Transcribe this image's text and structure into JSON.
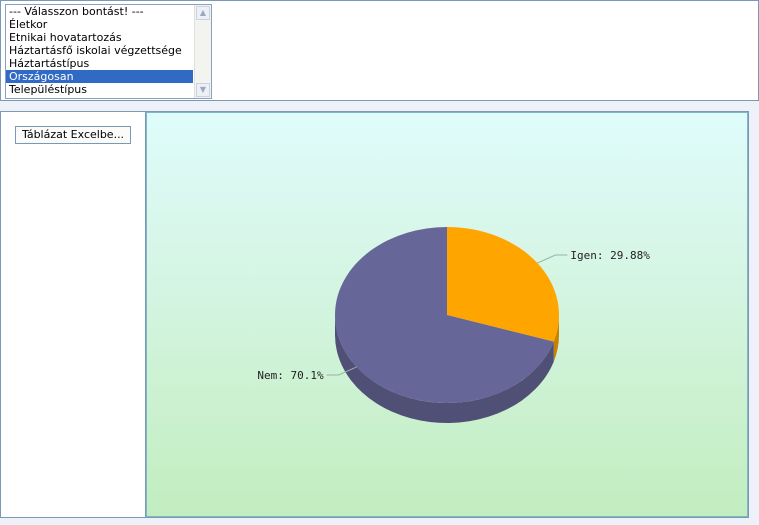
{
  "breakdown_select": {
    "options": [
      "--- Válasszon bontást! ---",
      "Életkor",
      "Etnikai hovatartozás",
      "Háztartásfő iskolai végzettsége",
      "Háztartástípus",
      "Országosan",
      "Településtípus"
    ],
    "selected": "Országosan"
  },
  "left_panel": {
    "excel_button_label": "Táblázat Excelbe..."
  },
  "chart_data": {
    "type": "pie",
    "slices": [
      {
        "name": "Igen",
        "value": 29.88,
        "label": "Igen: 29.88%",
        "color": "#ffa500"
      },
      {
        "name": "Nem",
        "value": 70.1,
        "label": "Nem: 70.1%",
        "color": "#666699"
      }
    ]
  },
  "colors": {
    "selection": "#316ac5",
    "panel_border": "#7a98b8",
    "pie_orange": "#ffa500",
    "pie_purple": "#666699"
  }
}
